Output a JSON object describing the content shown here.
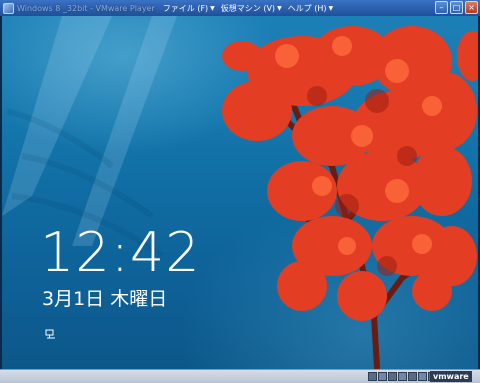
{
  "window": {
    "title": "Windows 8 _32bit - VMware Player",
    "menus": [
      {
        "label": "ファイル (F)"
      },
      {
        "label": "仮想マシン (V)"
      },
      {
        "label": "ヘルプ (H)"
      }
    ],
    "controls": {
      "minimize": "–",
      "maximize": "□",
      "close": "×"
    }
  },
  "lockscreen": {
    "time": "12:42",
    "date": "3月1日 木曜日",
    "status_icon": "network-icon"
  },
  "statusbar": {
    "brand": "vmware",
    "tray_icons": [
      "usb-icon",
      "network-adapter-icon",
      "cd-icon",
      "floppy-icon",
      "sound-icon",
      "printer-icon",
      "hdd-icon",
      "message-icon"
    ]
  },
  "colors": {
    "titlebar": "#1f4f9a",
    "sea": "#1577ad",
    "coral": "#e23a22"
  }
}
